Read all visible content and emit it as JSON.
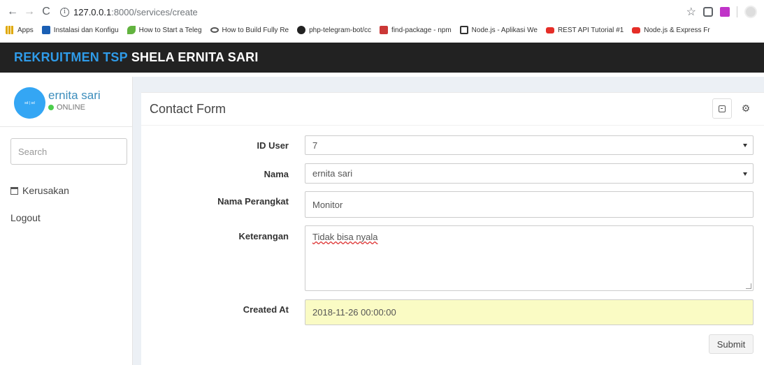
{
  "browser": {
    "url_host": "127.0.0.1",
    "url_path": ":8000/services/create",
    "bookmarks": [
      {
        "label": "Apps",
        "icon": "apps-grid-icon",
        "color": "#e0a800"
      },
      {
        "label": "Instalasi dan Konfigu",
        "icon": "site-icon",
        "color": "#1a5fb4"
      },
      {
        "label": "How to Start a Teleg",
        "icon": "leaf-icon",
        "color": "#62b33f"
      },
      {
        "label": "How to Build Fully Re",
        "icon": "glasses-icon",
        "color": "#555555"
      },
      {
        "label": "php-telegram-bot/cc",
        "icon": "github-icon",
        "color": "#222222"
      },
      {
        "label": "find-package - npm",
        "icon": "npm-icon",
        "color": "#cb3837"
      },
      {
        "label": "Node.js - Aplikasi We",
        "icon": "book-icon",
        "color": "#333333"
      },
      {
        "label": "REST API Tutorial #1",
        "icon": "youtube-icon",
        "color": "#e52d27"
      },
      {
        "label": "Node.js & Express Fr",
        "icon": "youtube-icon",
        "color": "#e52d27"
      }
    ]
  },
  "header": {
    "brand_primary": "REKRUITMEN TSP",
    "brand_secondary": "SHELA ERNITA SARI"
  },
  "sidebar": {
    "user_name": "ernita sari",
    "avatar_text": "sd | sd",
    "status": "ONLINE",
    "search_placeholder": "Search",
    "menu": [
      {
        "label": "Kerusakan",
        "icon": "calendar-icon"
      },
      {
        "label": "Logout"
      }
    ]
  },
  "form": {
    "title": "Contact Form",
    "fields": {
      "id_user": {
        "label": "ID User",
        "value": "7"
      },
      "nama": {
        "label": "Nama",
        "value": "ernita sari"
      },
      "nama_perangkat": {
        "label": "Nama Perangkat",
        "value": "Monitor"
      },
      "keterangan": {
        "label": "Keterangan",
        "value": "Tidak bisa nyala"
      },
      "created_at": {
        "label": "Created At",
        "value": "2018-11-26 00:00:00"
      }
    },
    "submit_label": "Submit"
  },
  "colors": {
    "brand_blue": "#2f9be8",
    "topbar_bg": "#222222",
    "online_green": "#4cce4c",
    "autofill_yellow": "#fafbc4"
  }
}
